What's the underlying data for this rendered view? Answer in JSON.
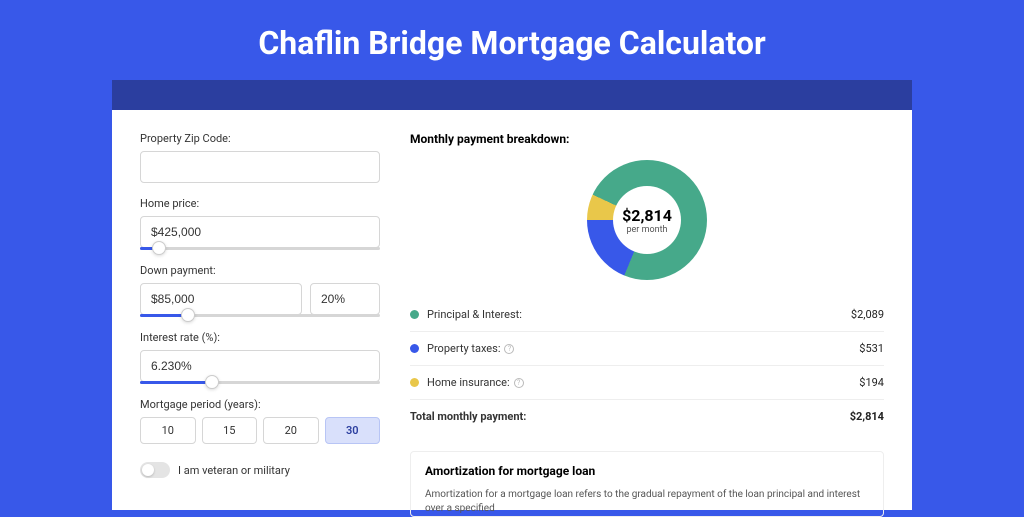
{
  "page": {
    "title": "Chaflin Bridge Mortgage Calculator"
  },
  "form": {
    "zip": {
      "label": "Property Zip Code:",
      "value": ""
    },
    "home_price": {
      "label": "Home price:",
      "value": "$425,000",
      "slider_pct": 8
    },
    "down_payment": {
      "label": "Down payment:",
      "value": "$85,000",
      "pct_value": "20%",
      "slider_pct": 20
    },
    "interest_rate": {
      "label": "Interest rate (%):",
      "value": "6.230%",
      "slider_pct": 30
    },
    "period": {
      "label": "Mortgage period (years):",
      "options": [
        "10",
        "15",
        "20",
        "30"
      ],
      "selected": "30"
    },
    "veteran": {
      "label": "I am veteran or military",
      "on": false
    }
  },
  "breakdown": {
    "title": "Monthly payment breakdown:",
    "center_value": "$2,814",
    "center_sub": "per month",
    "items": [
      {
        "label": "Principal & Interest:",
        "amount": "$2,089",
        "color": "#46a98a",
        "info": false
      },
      {
        "label": "Property taxes:",
        "amount": "$531",
        "color": "#3858e9",
        "info": true
      },
      {
        "label": "Home insurance:",
        "amount": "$194",
        "color": "#e9c74a",
        "info": true
      }
    ],
    "total": {
      "label": "Total monthly payment:",
      "amount": "$2,814"
    }
  },
  "chart_data": {
    "type": "pie",
    "title": "Monthly payment breakdown",
    "series": [
      {
        "name": "Principal & Interest",
        "value": 2089,
        "color": "#46a98a"
      },
      {
        "name": "Property taxes",
        "value": 531,
        "color": "#3858e9"
      },
      {
        "name": "Home insurance",
        "value": 194,
        "color": "#e9c74a"
      }
    ],
    "total": 2814,
    "center_label": "$2,814 per month"
  },
  "amortization": {
    "title": "Amortization for mortgage loan",
    "text": "Amortization for a mortgage loan refers to the gradual repayment of the loan principal and interest over a specified"
  }
}
